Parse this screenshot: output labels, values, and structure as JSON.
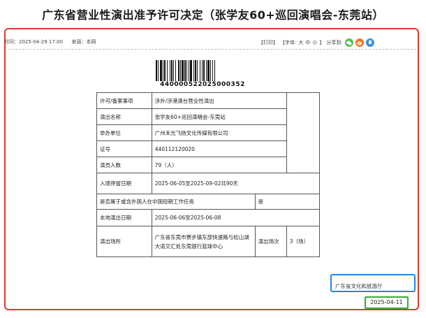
{
  "title": "广东省营业性演出准予许可决定（张学友60+巡回演唱会-东莞站）",
  "meta": {
    "time": "时间：2025-04-29 17:00",
    "source": "来源：本网"
  },
  "tools": {
    "print": "【打印】",
    "font_label": "【字体:",
    "font_large": "大",
    "font_medium": "中",
    "font_small": "小",
    "font_close": "】",
    "share_label": "分享到:"
  },
  "barcode_number": "440000522025000352",
  "permit": {
    "rows": [
      {
        "label": "许可/备案事项",
        "value": "涉外/涉港澳台营业性演出"
      },
      {
        "label": "演出名称",
        "value": "张学友60+巡回演唱会-东莞站"
      },
      {
        "label": "举办单位",
        "value": "广州禾光飞扬文化传媒有限公司"
      },
      {
        "label": "证号",
        "value": "440112120020"
      },
      {
        "label": "演员人数",
        "value": "79（人）"
      }
    ],
    "stay_label": "入境停留日期",
    "stay_value": "2025-06-05至2025-09-02共90天",
    "short_term_label": "是否属于或含外国人在中国短期工作任务",
    "short_term_value": "是",
    "dates_label": "本地演出日期",
    "dates_value": "2025-06-06至2025-06-08",
    "venue_label": "演出场所",
    "venue_value": "广东省东莞市寮步镇东部快速路与松山湖大道交汇处东莞银行篮球中心",
    "sessions_label": "演出场次",
    "sessions_value": "3（场）"
  },
  "authority": "广东省文化和旅游厅",
  "issue_date": "2025-04-11",
  "colors": {
    "frame": "#e03a2f",
    "blue_box": "#1e88e5",
    "green_box": "#2fae3a",
    "wechat": "#5cb85c",
    "weibo": "#e8792e",
    "qq": "#3d8fdc"
  }
}
